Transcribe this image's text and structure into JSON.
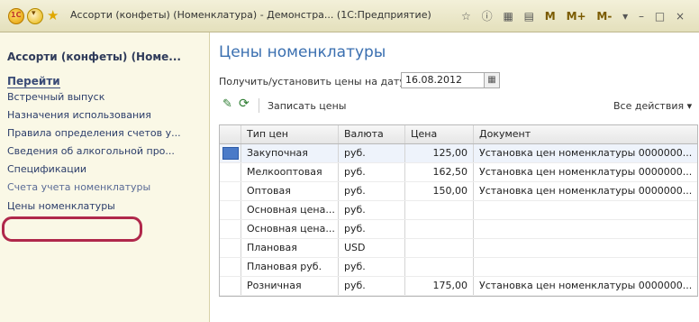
{
  "window": {
    "title": "Ассорти (конфеты) (Номенклатура) - Демонстра... (1С:Предприятие)",
    "toolbar_icons": [
      "star-icon",
      "info-icon",
      "calculator-icon",
      "calendar-icon",
      "M",
      "M+",
      "M-",
      "dropdown-icon",
      "minimize-icon",
      "close-icon"
    ],
    "m_label": "M",
    "mplus_label": "M+",
    "mminus_label": "M-"
  },
  "left_panel": {
    "title": "Ассорти (конфеты) (Номе...",
    "go_label": "Перейти",
    "items": [
      {
        "label": "Встречный выпуск"
      },
      {
        "label": "Назначения использования"
      },
      {
        "label": "Правила определения счетов у..."
      },
      {
        "label": "Сведения об алкогольной про..."
      },
      {
        "label": "Спецификации"
      },
      {
        "label": "Счета учета номенклатуры"
      },
      {
        "label": "Цены номенклатуры"
      }
    ]
  },
  "main": {
    "title": "Цены номенклатуры",
    "date_label": "Получить/установить цены на дату:",
    "date_value": "16.08.2012",
    "write_label": "Записать цены",
    "all_actions_label": "Все действия ▾",
    "columns": [
      "Тип цен",
      "Валюта",
      "Цена",
      "Документ"
    ],
    "rows": [
      {
        "type": "Закупочная",
        "currency": "руб.",
        "price": "125,00",
        "doc": "Установка цен номенклатуры 0000000..."
      },
      {
        "type": "Мелкооптовая",
        "currency": "руб.",
        "price": "162,50",
        "doc": "Установка цен номенклатуры 0000000..."
      },
      {
        "type": "Оптовая",
        "currency": "руб.",
        "price": "150,00",
        "doc": "Установка цен номенклатуры 0000000..."
      },
      {
        "type": "Основная цена...",
        "currency": "руб.",
        "price": "",
        "doc": ""
      },
      {
        "type": "Основная цена...",
        "currency": "руб.",
        "price": "",
        "doc": ""
      },
      {
        "type": "Плановая",
        "currency": "USD",
        "price": "",
        "doc": ""
      },
      {
        "type": "Плановая руб.",
        "currency": "руб.",
        "price": "",
        "doc": ""
      },
      {
        "type": "Розничная",
        "currency": "руб.",
        "price": "175,00",
        "doc": "Установка цен номенклатуры 0000000..."
      }
    ]
  }
}
